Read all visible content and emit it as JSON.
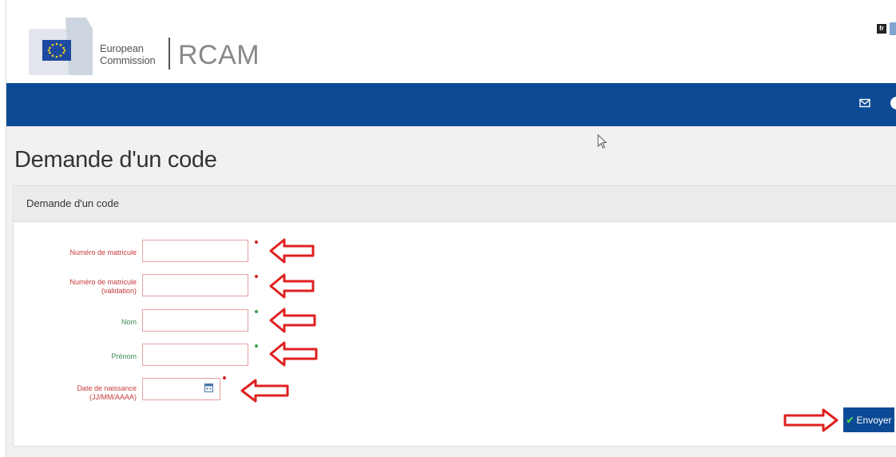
{
  "header": {
    "org_line1": "European",
    "org_line2": "Commission",
    "app_title": "RCAM",
    "language": "fr"
  },
  "nav": {
    "icons": [
      "mail-icon",
      "user-icon"
    ]
  },
  "page": {
    "title": "Demande d'un code"
  },
  "panel": {
    "title": "Demande d'un code"
  },
  "form": {
    "fields": [
      {
        "label": "Numéro de matricule",
        "value": "",
        "required": "red"
      },
      {
        "label_line1": "Numéro de matricule",
        "label_line2": "(validation)",
        "value": "",
        "required": "red"
      },
      {
        "label": "Nom",
        "value": "",
        "required": "green"
      },
      {
        "label": "Prénom",
        "value": "",
        "required": "green"
      },
      {
        "label_line1": "Date de naissance",
        "label_line2": "(JJ/MM/AAAA)",
        "value": "",
        "required": "red"
      }
    ],
    "submit_label": "Envoyer"
  },
  "colors": {
    "brand_blue": "#0d4a96",
    "required_red": "#d02020",
    "required_green": "#3aa050",
    "annotation_red": "#e02020"
  }
}
